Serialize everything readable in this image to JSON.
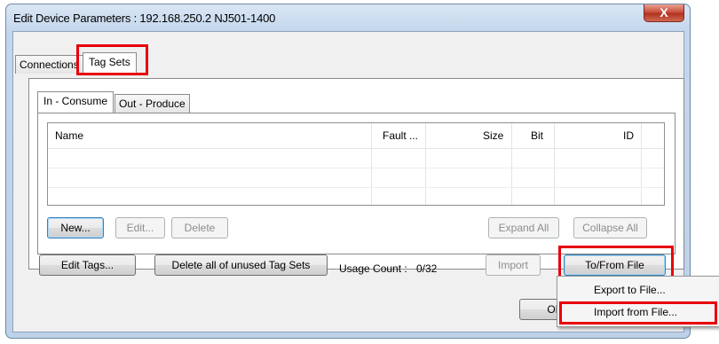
{
  "window": {
    "title": "Edit Device Parameters : 192.168.250.2 NJ501-1400",
    "close_glyph": "X"
  },
  "tabs": [
    {
      "label": "Connections",
      "active": false
    },
    {
      "label": "Tag Sets",
      "active": true
    }
  ],
  "subtabs": [
    {
      "label": "In - Consume",
      "active": true
    },
    {
      "label": "Out - Produce",
      "active": false
    }
  ],
  "table": {
    "columns": [
      "Name",
      "Fault ...",
      "Size",
      "Bit",
      "ID"
    ],
    "rows": []
  },
  "panel_buttons": {
    "new": "New...",
    "edit": "Edit...",
    "delete": "Delete",
    "expand_all": "Expand All",
    "collapse_all": "Collapse All"
  },
  "bottom": {
    "edit_tags": "Edit Tags...",
    "delete_unused": "Delete all of unused Tag Sets",
    "usage_label": "Usage Count :",
    "usage_value": "0/32",
    "import": "Import",
    "to_from_file": "To/From File",
    "ok": "OK"
  },
  "context_menu": {
    "items": [
      "Export to File...",
      "Import from File..."
    ]
  },
  "highlight_color": "#e8000b"
}
